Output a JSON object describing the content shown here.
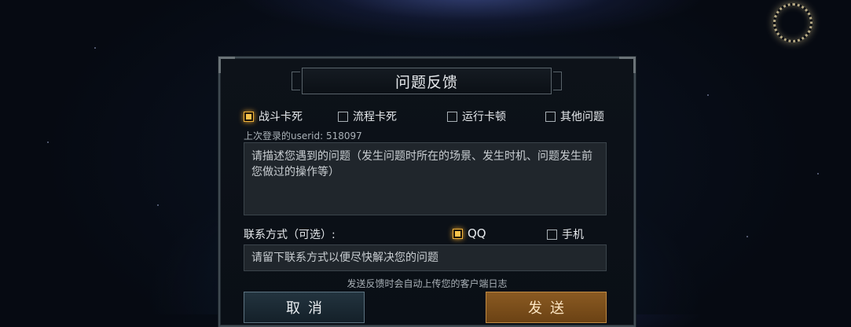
{
  "dialog": {
    "title": "问题反馈",
    "categories": [
      {
        "label": "战斗卡死",
        "checked": true
      },
      {
        "label": "流程卡死",
        "checked": false
      },
      {
        "label": "运行卡顿",
        "checked": false
      },
      {
        "label": "其他问题",
        "checked": false
      }
    ],
    "last_login": "上次登录的userid: 518097",
    "description_placeholder": "请描述您遇到的问题（发生问题时所在的场景、发生时机、问题发生前您做过的操作等）",
    "contact_label": "联系方式（可选）:",
    "contact_options": [
      {
        "label": "QQ",
        "checked": true
      },
      {
        "label": "手机",
        "checked": false
      }
    ],
    "contact_placeholder": "请留下联系方式以便尽快解决您的问题",
    "upload_note": "发送反馈时会自动上传您的客户端日志",
    "cancel_label": "取消",
    "send_label": "发送"
  },
  "colors": {
    "accent": "#f2b43a",
    "send_button": "#7a4e1c",
    "cancel_button": "#1c2a34"
  },
  "icons": {
    "top_right": "glowing-ring-icon"
  }
}
